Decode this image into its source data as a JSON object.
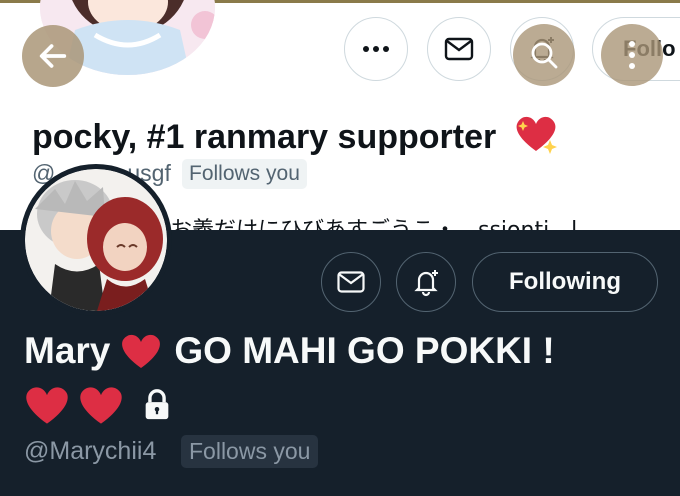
{
  "light_profile": {
    "more_icon": "more-dots-icon",
    "message_icon": "envelope-icon",
    "notify_icon": "bell-plus-icon",
    "follow_label": "Follo",
    "name": "pocky, #1 ranmary supporter",
    "name_emoji": "💖",
    "handle_start": "@",
    "handle_end": "usgf",
    "follows_you": "Follows you",
    "bio": "お義だけにひびあすごうこ・…ssionti…l…"
  },
  "dark_profile": {
    "message_icon": "envelope-icon",
    "notify_icon": "bell-plus-icon",
    "following_label": "Following",
    "name_part1": "Mary",
    "name_part2": "GO MAHI GO POKKI !",
    "handle": "@Marychii4",
    "follows_you": "Follows you",
    "lock_icon": "lock-icon"
  },
  "colors": {
    "dark_bg": "#15202b",
    "heart_red": "#dd2e44",
    "light_text": "#0f1419",
    "muted_text": "#536471"
  }
}
